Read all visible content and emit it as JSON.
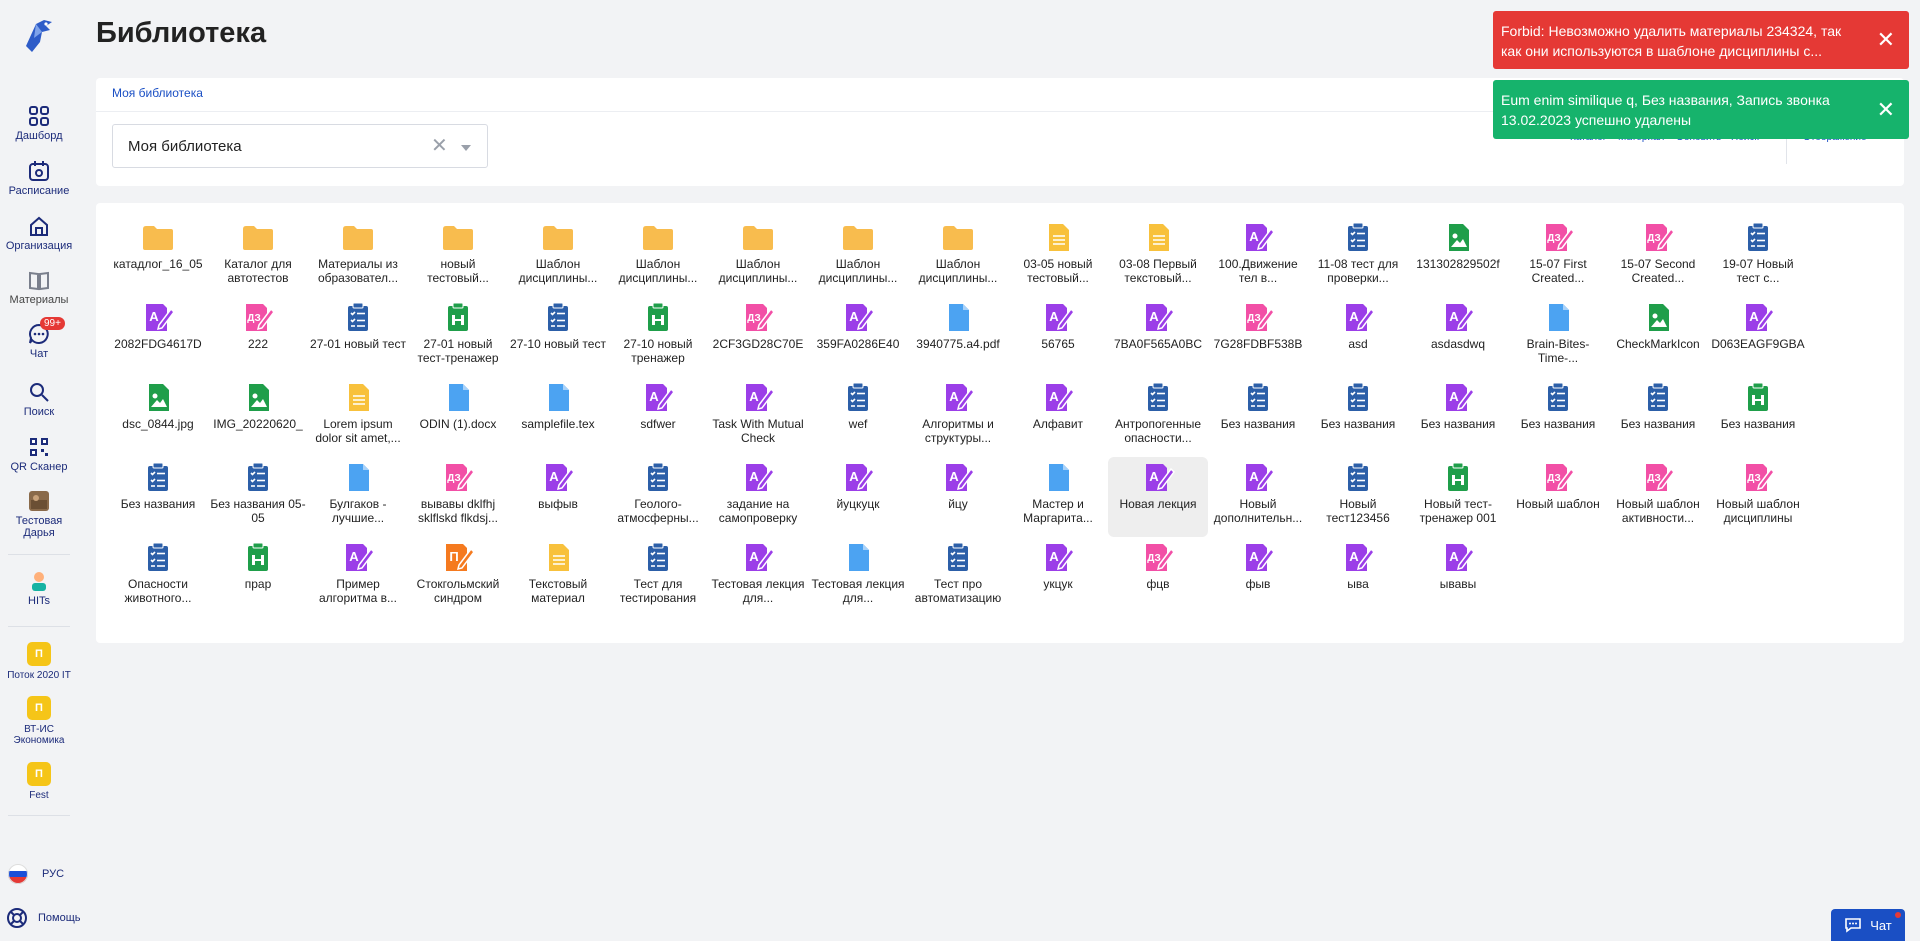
{
  "sidebar": {
    "nav": [
      {
        "label": "Дашборд",
        "icon": "dashboard-icon"
      },
      {
        "label": "Расписание",
        "icon": "calendar-icon"
      },
      {
        "label": "Организация",
        "icon": "organization-icon"
      },
      {
        "label": "Материалы",
        "icon": "book-icon"
      },
      {
        "label": "Чат",
        "icon": "chat-icon",
        "badge": "99+"
      },
      {
        "label": "Поиск",
        "icon": "search-icon"
      },
      {
        "label": "QR Сканер",
        "icon": "qr-icon"
      },
      {
        "label": "Тестовая Дарья",
        "icon": "avatar-icon"
      },
      {
        "label": "HITs",
        "icon": "hits-icon"
      }
    ],
    "streams": [
      {
        "letter": "П",
        "label": "Поток 2020 IT"
      },
      {
        "letter": "П",
        "label": "ВТ-ИС Экономика"
      },
      {
        "letter": "П",
        "label": "Fest"
      }
    ],
    "language": "РУС",
    "help": "Помощь"
  },
  "header": {
    "title": "Библиотека"
  },
  "breadcrumb": "Моя библиотека",
  "library_select": {
    "value": "Моя библиотека"
  },
  "toolbar": [
    {
      "label": "Каталог",
      "icon": "catalog-icon"
    },
    {
      "label": "Материал",
      "icon": "material-icon"
    },
    {
      "label": "Обновить",
      "icon": "refresh-icon"
    },
    {
      "label": "Поиск",
      "icon": "search-icon"
    },
    {
      "label": "Отображение",
      "icon": "view-icon"
    }
  ],
  "colors": {
    "folder": "#f8bc4e",
    "doc_yellow": "#f8c13c",
    "assignment": "#9b3ee8",
    "homework": "#f24fa6",
    "test": "#2c5fa8",
    "trainer": "#1f9e4a",
    "file": "#4ca3f2",
    "image": "#1f9e4a",
    "orange": "#f57a1f"
  },
  "items": [
    {
      "name": "катадлог_16_05",
      "type": "folder"
    },
    {
      "name": "Каталог для автотестов",
      "type": "folder"
    },
    {
      "name": "Материалы из образовател...",
      "type": "folder"
    },
    {
      "name": "новый тестовый...",
      "type": "folder"
    },
    {
      "name": "Шаблон дисциплины...",
      "type": "folder"
    },
    {
      "name": "Шаблон дисциплины...",
      "type": "folder"
    },
    {
      "name": "Шаблон дисциплины...",
      "type": "folder"
    },
    {
      "name": "Шаблон дисциплины...",
      "type": "folder"
    },
    {
      "name": "Шаблон дисциплины...",
      "type": "folder"
    },
    {
      "name": "03-05 новый тестовый...",
      "type": "doc"
    },
    {
      "name": "03-08 Первый текстовый...",
      "type": "doc"
    },
    {
      "name": "100.Движение тел в...",
      "type": "assignment"
    },
    {
      "name": "11-08 тест для проверки...",
      "type": "test"
    },
    {
      "name": "131302829502f",
      "type": "image"
    },
    {
      "name": "15-07 First Created...",
      "type": "homework"
    },
    {
      "name": "15-07 Second Created...",
      "type": "homework"
    },
    {
      "name": "19-07 Новый тест с...",
      "type": "test"
    },
    {
      "name": "2082FDG4617D",
      "type": "assignment"
    },
    {
      "name": "222",
      "type": "homework"
    },
    {
      "name": "27-01 новый тест",
      "type": "test"
    },
    {
      "name": "27-01 новый тест-тренажер",
      "type": "trainer"
    },
    {
      "name": "27-10 новый тест",
      "type": "test"
    },
    {
      "name": "27-10 новый тренажер",
      "type": "trainer"
    },
    {
      "name": "2CF3GD28C70E",
      "type": "homework"
    },
    {
      "name": "359FA0286E40",
      "type": "assignment"
    },
    {
      "name": "3940775.a4.pdf",
      "type": "file"
    },
    {
      "name": "56765",
      "type": "assignment"
    },
    {
      "name": "7BA0F565A0BC",
      "type": "assignment"
    },
    {
      "name": "7G28FDBF538B",
      "type": "homework"
    },
    {
      "name": "asd",
      "type": "assignment"
    },
    {
      "name": "asdasdwq",
      "type": "assignment"
    },
    {
      "name": "Brain-Bites-Time-...",
      "type": "file"
    },
    {
      "name": "CheckMarkIcon",
      "type": "image"
    },
    {
      "name": "D063EAGF9GBA",
      "type": "assignment"
    },
    {
      "name": "dsc_0844.jpg",
      "type": "image"
    },
    {
      "name": "IMG_20220620_",
      "type": "image"
    },
    {
      "name": "Lorem ipsum dolor sit amet,...",
      "type": "doc"
    },
    {
      "name": "ODIN (1).docx",
      "type": "file"
    },
    {
      "name": "samplefile.tex",
      "type": "file"
    },
    {
      "name": "sdfwer",
      "type": "assignment"
    },
    {
      "name": "Task With Mutual Check",
      "type": "assignment"
    },
    {
      "name": "wef",
      "type": "test"
    },
    {
      "name": "Алгоритмы и структуры...",
      "type": "assignment"
    },
    {
      "name": "Алфавит",
      "type": "assignment"
    },
    {
      "name": "Антропогенные опасности...",
      "type": "test"
    },
    {
      "name": "Без названия",
      "type": "test"
    },
    {
      "name": "Без названия",
      "type": "test"
    },
    {
      "name": "Без названия",
      "type": "assignment"
    },
    {
      "name": "Без названия",
      "type": "test"
    },
    {
      "name": "Без названия",
      "type": "test"
    },
    {
      "name": "Без названия",
      "type": "trainer"
    },
    {
      "name": "Без названия",
      "type": "test"
    },
    {
      "name": "Без названия 05-05",
      "type": "test"
    },
    {
      "name": "Булгаков - лучшие...",
      "type": "file"
    },
    {
      "name": "вывавы dklfhj sklflskd flkdsj...",
      "type": "homework"
    },
    {
      "name": "выфыв",
      "type": "assignment"
    },
    {
      "name": "Геолого-атмосферны...",
      "type": "test"
    },
    {
      "name": "задание на самопроверку",
      "type": "assignment"
    },
    {
      "name": "йуцкуцк",
      "type": "assignment"
    },
    {
      "name": "йцу",
      "type": "assignment"
    },
    {
      "name": "Мастер и Маргарита...",
      "type": "file"
    },
    {
      "name": "Новая лекция",
      "type": "assignment",
      "selected": true
    },
    {
      "name": "Новый дополнительн...",
      "type": "assignment"
    },
    {
      "name": "Новый тест123456",
      "type": "test"
    },
    {
      "name": "Новый тест-тренажер 001",
      "type": "trainer"
    },
    {
      "name": "Новый шаблон",
      "type": "homework"
    },
    {
      "name": "Новый шаблон активности...",
      "type": "homework"
    },
    {
      "name": "Новый шаблон дисциплины",
      "type": "homework"
    },
    {
      "name": "Опасности животного...",
      "type": "test"
    },
    {
      "name": "прар",
      "type": "trainer"
    },
    {
      "name": "Пример алгоритма в...",
      "type": "assignment"
    },
    {
      "name": "Стокгольмский синдром",
      "type": "orange"
    },
    {
      "name": "Текстовый материал",
      "type": "doc"
    },
    {
      "name": "Тест для тестирования",
      "type": "test"
    },
    {
      "name": "Тестовая лекция для...",
      "type": "assignment"
    },
    {
      "name": "Тестовая лекция для...",
      "type": "file"
    },
    {
      "name": "Тест про автоматизацию",
      "type": "test"
    },
    {
      "name": "укцук",
      "type": "assignment"
    },
    {
      "name": "фцв",
      "type": "homework"
    },
    {
      "name": "фыв",
      "type": "assignment"
    },
    {
      "name": "ыва",
      "type": "assignment"
    },
    {
      "name": "ывавы",
      "type": "assignment"
    }
  ],
  "toasts": {
    "error": "Forbid: Невозможно удалить материалы 234324, так как они используются в шаблоне дисциплины с...",
    "success": "Eum enim similique q, Без названия, Запись звонка 13.02.2023 успешно удалены"
  },
  "chat_button": "Чат"
}
